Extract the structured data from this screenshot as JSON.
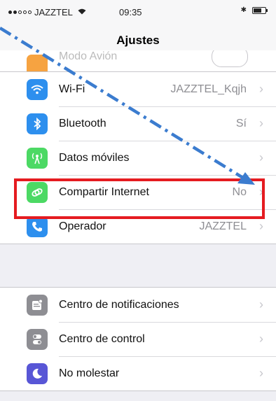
{
  "status_bar": {
    "carrier": "JAZZTEL",
    "time": "09:35",
    "bluetooth_glyph": "✱"
  },
  "nav": {
    "title": "Ajustes"
  },
  "faded_row": {
    "label": "Modo Avión"
  },
  "group_network": [
    {
      "name": "wifi",
      "label": "Wi-Fi",
      "value": "JAZZTEL_Kqjh",
      "icon": "wifi-icon",
      "color": "#2d8fee"
    },
    {
      "name": "bluetooth",
      "label": "Bluetooth",
      "value": "Sí",
      "icon": "bluetooth-icon",
      "color": "#2d8fee"
    },
    {
      "name": "mobile-data",
      "label": "Datos móviles",
      "value": "",
      "icon": "antenna-icon",
      "color": "#4cd964"
    },
    {
      "name": "hotspot",
      "label": "Compartir Internet",
      "value": "No",
      "icon": "chain-link-icon",
      "color": "#4cd964"
    },
    {
      "name": "carrier",
      "label": "Operador",
      "value": "JAZZTEL",
      "icon": "phone-icon",
      "color": "#2d8fee"
    }
  ],
  "group_system": [
    {
      "name": "notifications",
      "label": "Centro de notificaciones",
      "value": "",
      "icon": "notifications-icon",
      "color": "#8e8e93"
    },
    {
      "name": "control-center",
      "label": "Centro de control",
      "value": "",
      "icon": "toggles-icon",
      "color": "#8e8e93"
    },
    {
      "name": "do-not-disturb",
      "label": "No molestar",
      "value": "",
      "icon": "moon-icon",
      "color": "#5856d6"
    }
  ],
  "chevron": "›",
  "annotation": {
    "highlight_color": "#e51b20",
    "arrow_color": "#3b7ccf"
  }
}
